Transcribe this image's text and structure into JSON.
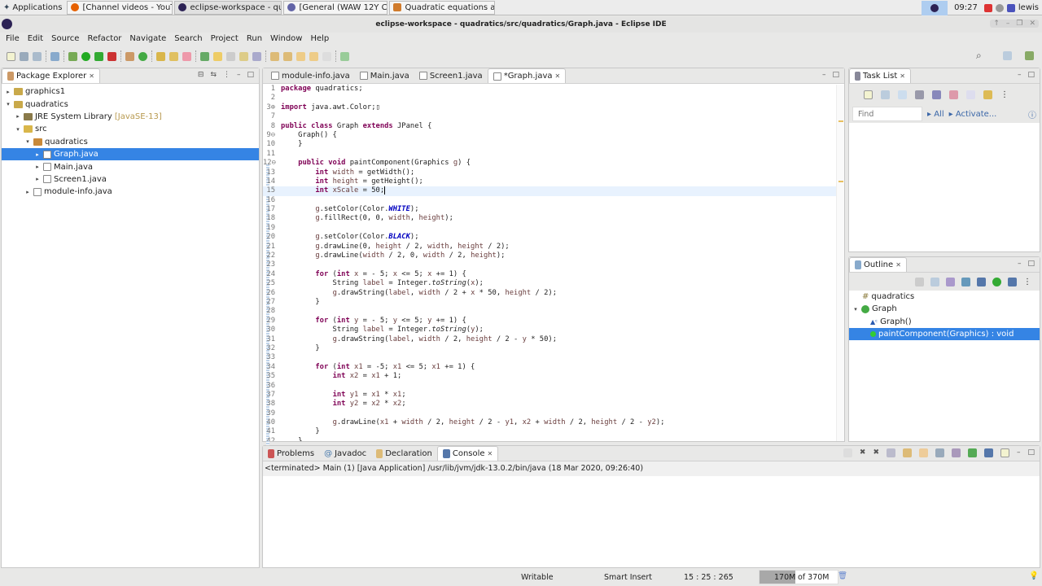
{
  "taskbar": {
    "apps_label": "Applications",
    "tasks": [
      {
        "label": "[Channel videos - YouTu...",
        "color": "#e66000"
      },
      {
        "label": "eclipse-workspace - qua...",
        "color": "#2c2255"
      },
      {
        "label": "[General (WAW 12Y Co...",
        "color": "#6264a7"
      },
      {
        "label": "Quadratic equations app",
        "color": "#d07b2c"
      }
    ],
    "clock": "09:27",
    "user": "lewis"
  },
  "window": {
    "title": "eclipse-workspace - quadratics/src/quadratics/Graph.java - Eclipse IDE"
  },
  "menu": [
    "File",
    "Edit",
    "Source",
    "Refactor",
    "Navigate",
    "Search",
    "Project",
    "Run",
    "Window",
    "Help"
  ],
  "package_explorer": {
    "title": "Package Explorer",
    "items": [
      {
        "label": "graphics1",
        "arrow": "▸"
      },
      {
        "label": "quadratics",
        "arrow": "▾"
      },
      {
        "label": "JRE System Library",
        "extra": "[JavaSE-13]",
        "arrow": "▸"
      },
      {
        "label": "src",
        "arrow": "▾"
      },
      {
        "label": "quadratics",
        "arrow": "▾"
      },
      {
        "label": "Graph.java",
        "arrow": "▸"
      },
      {
        "label": "Main.java",
        "arrow": "▸"
      },
      {
        "label": "Screen1.java",
        "arrow": "▸"
      },
      {
        "label": "module-info.java",
        "arrow": "▸"
      }
    ]
  },
  "editor": {
    "tabs": [
      "module-info.java",
      "Main.java",
      "Screen1.java",
      "*Graph.java"
    ],
    "lines": [
      {
        "n": "1",
        "t": "package quadratics;"
      },
      {
        "n": "2",
        "t": ""
      },
      {
        "n": "3⊕",
        "t": "import java.awt.Color;▯"
      },
      {
        "n": "7",
        "t": ""
      },
      {
        "n": "8",
        "t": "public class Graph extends JPanel {"
      },
      {
        "n": "9⊖",
        "t": "    Graph() {"
      },
      {
        "n": "10",
        "t": "    }"
      },
      {
        "n": "11",
        "t": ""
      },
      {
        "n": "12⊖",
        "t": "    public void paintComponent(Graphics g) {"
      },
      {
        "n": "13",
        "t": "        int width = getWidth();"
      },
      {
        "n": "14",
        "t": "        int height = getHeight();"
      },
      {
        "n": "15",
        "t": "        int xScale = 50;"
      },
      {
        "n": "16",
        "t": ""
      },
      {
        "n": "17",
        "t": "        g.setColor(Color.WHITE);"
      },
      {
        "n": "18",
        "t": "        g.fillRect(0, 0, width, height);"
      },
      {
        "n": "19",
        "t": ""
      },
      {
        "n": "20",
        "t": "        g.setColor(Color.BLACK);"
      },
      {
        "n": "21",
        "t": "        g.drawLine(0, height / 2, width, height / 2);"
      },
      {
        "n": "22",
        "t": "        g.drawLine(width / 2, 0, width / 2, height);"
      },
      {
        "n": "23",
        "t": ""
      },
      {
        "n": "24",
        "t": "        for (int x = - 5; x <= 5; x += 1) {"
      },
      {
        "n": "25",
        "t": "            String label = Integer.toString(x);"
      },
      {
        "n": "26",
        "t": "            g.drawString(label, width / 2 + x * 50, height / 2);"
      },
      {
        "n": "27",
        "t": "        }"
      },
      {
        "n": "28",
        "t": ""
      },
      {
        "n": "29",
        "t": "        for (int y = - 5; y <= 5; y += 1) {"
      },
      {
        "n": "30",
        "t": "            String label = Integer.toString(y);"
      },
      {
        "n": "31",
        "t": "            g.drawString(label, width / 2, height / 2 - y * 50);"
      },
      {
        "n": "32",
        "t": "        }"
      },
      {
        "n": "33",
        "t": ""
      },
      {
        "n": "34",
        "t": "        for (int x1 = -5; x1 <= 5; x1 += 1) {"
      },
      {
        "n": "35",
        "t": "            int x2 = x1 + 1;"
      },
      {
        "n": "36",
        "t": ""
      },
      {
        "n": "37",
        "t": "            int y1 = x1 * x1;"
      },
      {
        "n": "38",
        "t": "            int y2 = x2 * x2;"
      },
      {
        "n": "39",
        "t": ""
      },
      {
        "n": "40",
        "t": "            g.drawLine(x1 + width / 2, height / 2 - y1, x2 + width / 2, height / 2 - y2);"
      },
      {
        "n": "41",
        "t": "        }"
      },
      {
        "n": "42",
        "t": "    }"
      }
    ]
  },
  "task_list": {
    "title": "Task List",
    "find_placeholder": "Find",
    "all": "All",
    "activate": "Activate..."
  },
  "outline": {
    "title": "Outline",
    "items": [
      {
        "label": "quadratics"
      },
      {
        "label": "Graph",
        "arrow": "▾"
      },
      {
        "label": "Graph()"
      },
      {
        "label": "paintComponent(Graphics) : void"
      }
    ]
  },
  "console": {
    "tabs": [
      "Problems",
      "Javadoc",
      "Declaration",
      "Console"
    ],
    "status": "<terminated> Main (1) [Java Application] /usr/lib/jvm/jdk-13.0.2/bin/java (18 Mar 2020, 09:26:40)"
  },
  "statusbar": {
    "writable": "Writable",
    "insert": "Smart Insert",
    "position": "15 : 25 : 265",
    "heap_used": "170M",
    "heap_total": "of 370M",
    "heap_fraction": 0.46
  }
}
